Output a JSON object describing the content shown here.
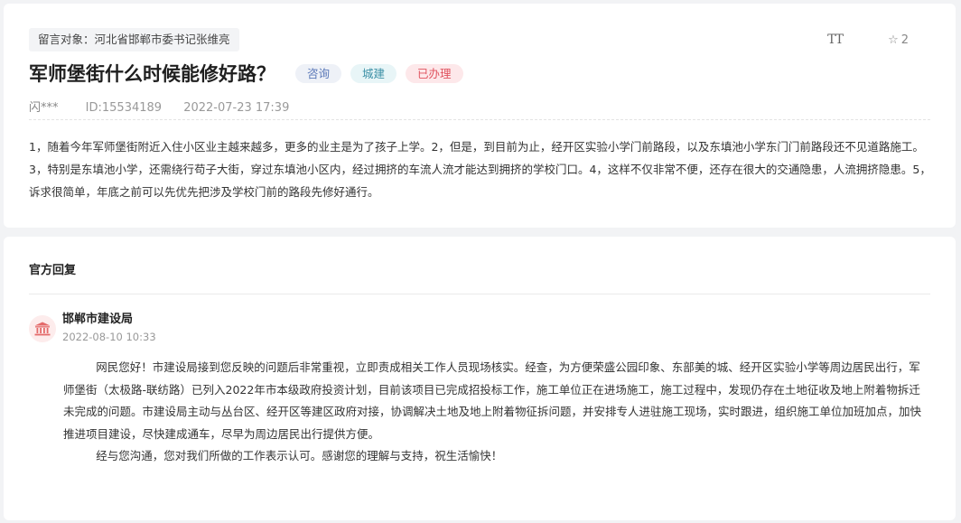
{
  "question": {
    "target_label": "留言对象：",
    "target_name": "河北省邯郸市委书记张维亮",
    "title": "军师堡街什么时候能修好路？",
    "tags": {
      "category1": "咨询",
      "category2": "城建",
      "status": "已办理"
    },
    "toolbar": {
      "font_size_label": "TT",
      "favorite_count": "2"
    },
    "author": "闪***",
    "id_text": "ID:15534189",
    "datetime": "2022-07-23 17:39",
    "content": "1，随着今年军师堡街附近入住小区业主越来越多，更多的业主是为了孩子上学。2，但是，到目前为止，经开区实验小学门前路段，以及东填池小学东门门前路段还不见道路施工。3，特别是东填池小学，还需绕行苟子大街，穿过东填池小区内，经过拥挤的车流人流才能达到拥挤的学校门口。4，这样不仅非常不便，还存在很大的交通隐患，人流拥挤隐患。5，诉求很简单，年底之前可以先优先把涉及学校门前的路段先修好通行。"
  },
  "reply": {
    "section_title": "官方回复",
    "department": "邯郸市建设局",
    "datetime": "2022-08-10 10:33",
    "paragraph1": "网民您好！市建设局接到您反映的问题后非常重视，立即责成相关工作人员现场核实。经查，为方便荣盛公园印象、东部美的城、经开区实验小学等周边居民出行，军师堡街（太极路-联纺路）已列入2022年市本级政府投资计划，目前该项目已完成招投标工作，施工单位正在进场施工，施工过程中，发现仍存在土地征收及地上附着物拆迁未完成的问题。市建设局主动与丛台区、经开区等建区政府对接，协调解决土地及地上附着物征拆问题，并安排专人进驻施工现场，实时跟进，组织施工单位加班加点，加快推进项目建设，尽快建成通车，尽早为周边居民出行提供方便。",
    "paragraph2": "经与您沟通，您对我们所做的工作表示认可。感谢您的理解与支持，祝生活愉快！",
    "avatar_icon": "government-building-icon",
    "avatar_color": "#e46a6a"
  }
}
